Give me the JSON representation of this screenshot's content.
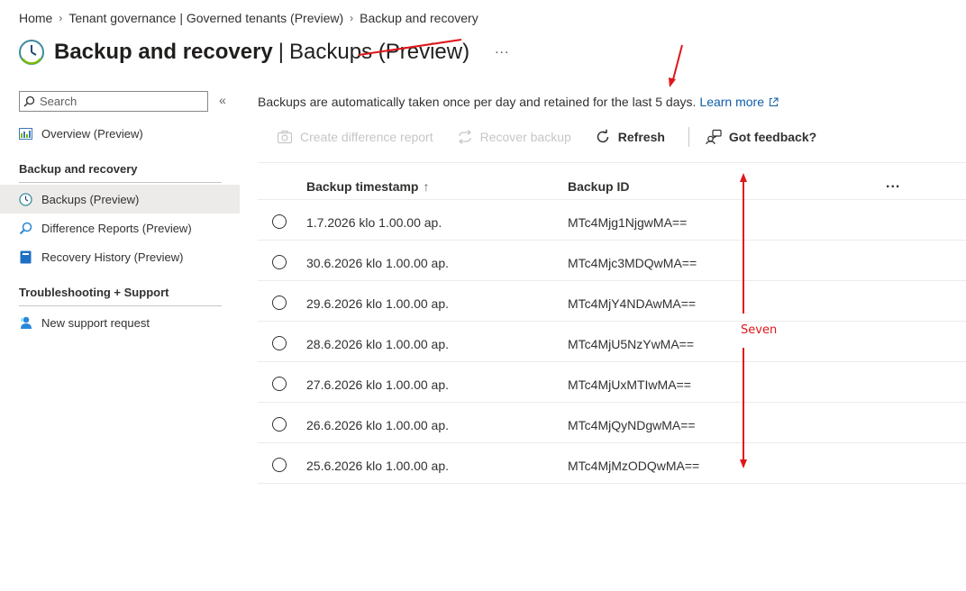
{
  "breadcrumb": {
    "items": [
      "Home",
      "Tenant governance | Governed tenants (Preview)",
      "Backup and recovery"
    ]
  },
  "header": {
    "title": "Backup and recovery",
    "separator": "|",
    "subtitle": "Backups (Preview)",
    "more": "..."
  },
  "sidebar": {
    "search_placeholder": "Search",
    "collapse": "«",
    "overview": "Overview (Preview)",
    "group1": "Backup and recovery",
    "backups": "Backups (Preview)",
    "difference_reports": "Difference Reports (Preview)",
    "recovery_history": "Recovery History (Preview)",
    "group2": "Troubleshooting + Support",
    "support": "New support request"
  },
  "info": {
    "text": "Backups are automatically taken once per day and retained for the last 5 days.",
    "link": "Learn more"
  },
  "toolbar": {
    "create_diff": "Create difference report",
    "recover": "Recover backup",
    "refresh": "Refresh",
    "feedback": "Got feedback?"
  },
  "table": {
    "col_timestamp": "Backup timestamp",
    "sort_arrow": "↑",
    "col_id": "Backup ID",
    "more": "...",
    "rows": [
      {
        "timestamp": "1.7.2026 klo 1.00.00 ap.",
        "id": "MTc4Mjg1NjgwMA=="
      },
      {
        "timestamp": "30.6.2026 klo 1.00.00 ap.",
        "id": "MTc4Mjc3MDQwMA=="
      },
      {
        "timestamp": "29.6.2026 klo 1.00.00 ap.",
        "id": "MTc4MjY4NDAwMA=="
      },
      {
        "timestamp": "28.6.2026 klo 1.00.00 ap.",
        "id": "MTc4MjU5NzYwMA=="
      },
      {
        "timestamp": "27.6.2026 klo 1.00.00 ap.",
        "id": "MTc4MjUxMTIwMA=="
      },
      {
        "timestamp": "26.6.2026 klo 1.00.00 ap.",
        "id": "MTc4MjQyNDgwMA=="
      },
      {
        "timestamp": "25.6.2026 klo 1.00.00 ap.",
        "id": "MTc4MjMzODQwMA=="
      }
    ]
  },
  "annotation": {
    "label": "Seven",
    "color": "#e0161b"
  },
  "colors": {
    "link": "#0f5ea8",
    "active_nav": "#edebe9",
    "disabled": "#c8c6c4"
  }
}
